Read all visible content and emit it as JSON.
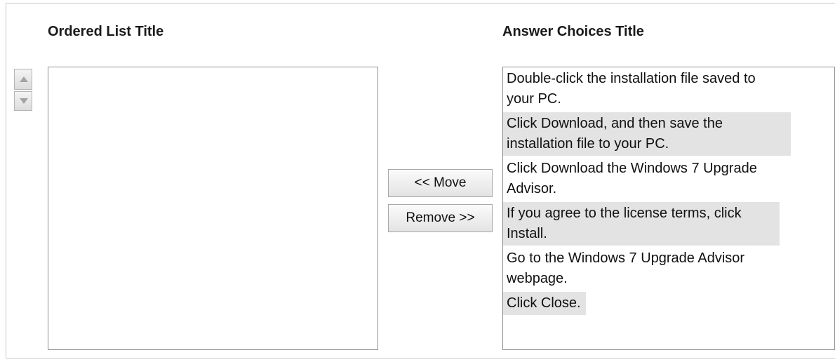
{
  "ordered_list": {
    "title": "Ordered List Title",
    "items": []
  },
  "answer_choices": {
    "title": "Answer Choices Title",
    "items": [
      "Double-click the installation file saved to your PC.",
      "Click Download, and then save the installation file to your PC.",
      "Click Download the Windows 7 Upgrade Advisor.",
      "If you agree to the license terms, click Install.",
      "Go to the Windows 7 Upgrade Advisor webpage.",
      "Click Close."
    ]
  },
  "buttons": {
    "move_label": "<< Move",
    "remove_label": "Remove >>"
  },
  "icons": {
    "up": "arrow-up-icon",
    "down": "arrow-down-icon"
  },
  "colors": {
    "alt_row": "#e3e3e3",
    "border": "#8e8e8e",
    "arrow": "#9a9a9a"
  }
}
